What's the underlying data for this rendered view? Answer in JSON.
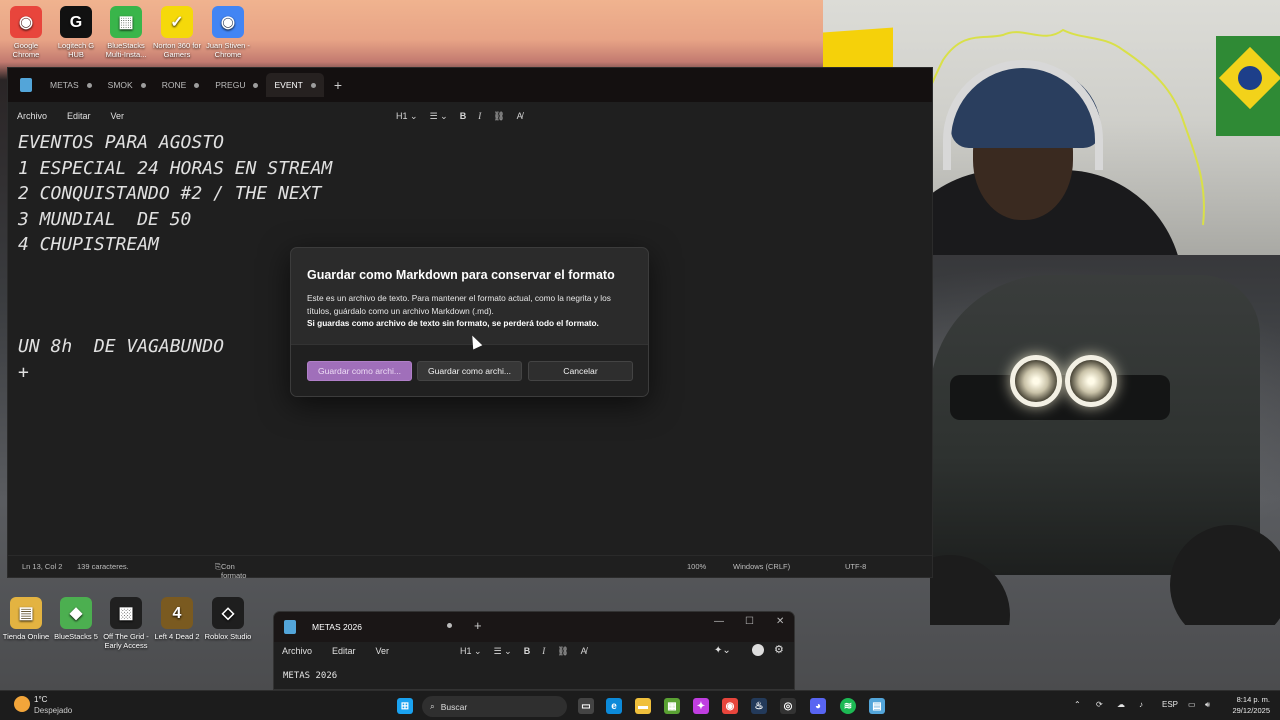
{
  "desktop": {
    "top_icons": [
      {
        "label": "Google Chrome",
        "color": "#e8453c",
        "glyph": "◉"
      },
      {
        "label": "Logitech G HUB",
        "color": "#111111",
        "glyph": "G"
      },
      {
        "label": "BlueStacks Multi-Insta...",
        "color": "#39b54a",
        "glyph": "▦"
      },
      {
        "label": "Norton 360 for Gamers",
        "color": "#f5d90a",
        "glyph": "✓"
      },
      {
        "label": "Juan Stiven - Chrome",
        "color": "#4285f4",
        "glyph": "◉"
      }
    ],
    "bottom_icons": [
      {
        "label": "Tienda Online",
        "color": "#e3b341",
        "glyph": "▤"
      },
      {
        "label": "BlueStacks 5",
        "color": "#4caf50",
        "glyph": "◆"
      },
      {
        "label": "Off The Grid - Early Access",
        "color": "#202020",
        "glyph": "▩"
      },
      {
        "label": "Left 4 Dead 2",
        "color": "#7a5a20",
        "glyph": "4"
      },
      {
        "label": "Roblox Studio",
        "color": "#1e1e1e",
        "glyph": "◇"
      }
    ]
  },
  "notepad": {
    "tabs": [
      "METAS",
      "SMOK",
      "RONE",
      "PREGU",
      "EVENT"
    ],
    "active_tab": "EVENT",
    "menu": [
      "Archivo",
      "Editar",
      "Ver"
    ],
    "heading_selector": "H1",
    "content": "EVENTOS PARA AGOSTO\n1 ESPECIAL 24 HORAS EN STREAM\n2 CONQUISTANDO #2 / THE NEXT\n3 MUNDIAL  DE 50\n4 CHUPISTREAM\n\n\n\nUN 8h  DE VAGABUNDO\n+",
    "status": {
      "position": "Ln 13, Col 2",
      "chars": "139 caracteres.",
      "format": "Con formato",
      "zoom": "100%",
      "line_ending": "Windows (CRLF)",
      "encoding": "UTF-8"
    }
  },
  "dialog": {
    "title": "Guardar como Markdown para conservar el formato",
    "body": "Este es un archivo de texto. Para mantener el formato actual, como la negrita y los títulos, guárdalo como un archivo Markdown (.md).",
    "warning": "Si guardas como archivo de texto sin formato, se perderá todo el formato.",
    "btn_markdown": "Guardar como archi...",
    "btn_text": "Guardar como archi...",
    "btn_cancel": "Cancelar"
  },
  "notepad2": {
    "tab": "METAS 2026",
    "menu": [
      "Archivo",
      "Editar",
      "Ver"
    ],
    "heading_selector": "H1",
    "content": "METAS 2026"
  },
  "taskbar": {
    "weather_temp": "1°C",
    "weather_desc": "Despejado",
    "search_placeholder": "Buscar",
    "language": "ESP",
    "time": "8:14 p. m.",
    "date": "29/12/2025"
  },
  "colors": {
    "dialog_primary": "#a06fba",
    "notepad_bg": "#1f1f1f"
  }
}
